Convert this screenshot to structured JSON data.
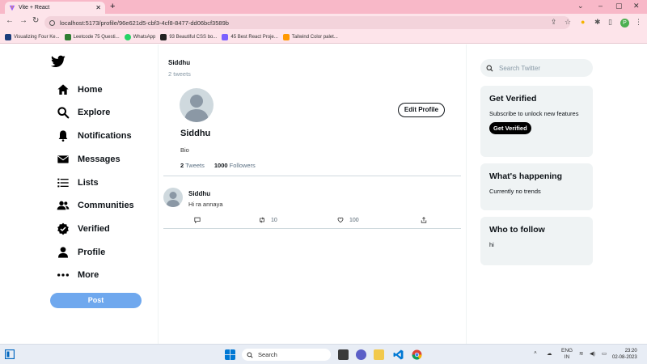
{
  "browser": {
    "tab_title": "Vite + React",
    "url": "localhost:5173/profile/96e621d5-cbf3-4cf8-8477-dd06bcf3589b",
    "profile_initial": "P",
    "bookmarks": [
      {
        "label": "Visualizing Four Ke...",
        "color": "#1a3d7c"
      },
      {
        "label": "Leetcode 75 Questi...",
        "color": "#2e7d32"
      },
      {
        "label": "WhatsApp",
        "color": "#25d366"
      },
      {
        "label": "93 Beautiful CSS bo...",
        "color": "#222222"
      },
      {
        "label": "45 Best React Proje...",
        "color": "#7b61ff"
      },
      {
        "label": "Tailwind Color palet...",
        "color": "#ff9800"
      }
    ]
  },
  "sidebar": {
    "items": [
      {
        "label": "Home",
        "icon": "home-icon"
      },
      {
        "label": "Explore",
        "icon": "search-icon"
      },
      {
        "label": "Notifications",
        "icon": "bell-icon"
      },
      {
        "label": "Messages",
        "icon": "mail-icon"
      },
      {
        "label": "Lists",
        "icon": "list-icon"
      },
      {
        "label": "Communities",
        "icon": "people-icon"
      },
      {
        "label": "Verified",
        "icon": "verified-icon"
      },
      {
        "label": "Profile",
        "icon": "person-icon"
      },
      {
        "label": "More",
        "icon": "more-icon"
      }
    ],
    "post_label": "Post"
  },
  "profile": {
    "header_name": "Siddhu",
    "header_count": "2 tweets",
    "name": "Siddhu",
    "bio": "Bio",
    "edit_label": "Edit Profile",
    "tweets_count": "2",
    "tweets_label": "Tweets",
    "followers_count": "1000",
    "followers_label": "Followers"
  },
  "tweet": {
    "author": "Siddhu",
    "text": "Hi ra annaya",
    "retweets": "10",
    "likes": "100"
  },
  "right": {
    "search_placeholder": "Search Twitter",
    "verified": {
      "title": "Get Verified",
      "body": "Subscribe to unlock new features",
      "button": "Get Verified"
    },
    "happening": {
      "title": "What's happening",
      "body": "Currently no trends"
    },
    "follow": {
      "title": "Who to follow",
      "body": "hi"
    }
  },
  "taskbar": {
    "search_label": "Search",
    "lang_top": "ENG",
    "lang_bottom": "IN",
    "time": "23:20",
    "date": "02-08-2023"
  },
  "colors": {
    "accent": "#1d9bf0",
    "post_button": "#6fa8ee",
    "browser_frame": "#fde4ea"
  }
}
